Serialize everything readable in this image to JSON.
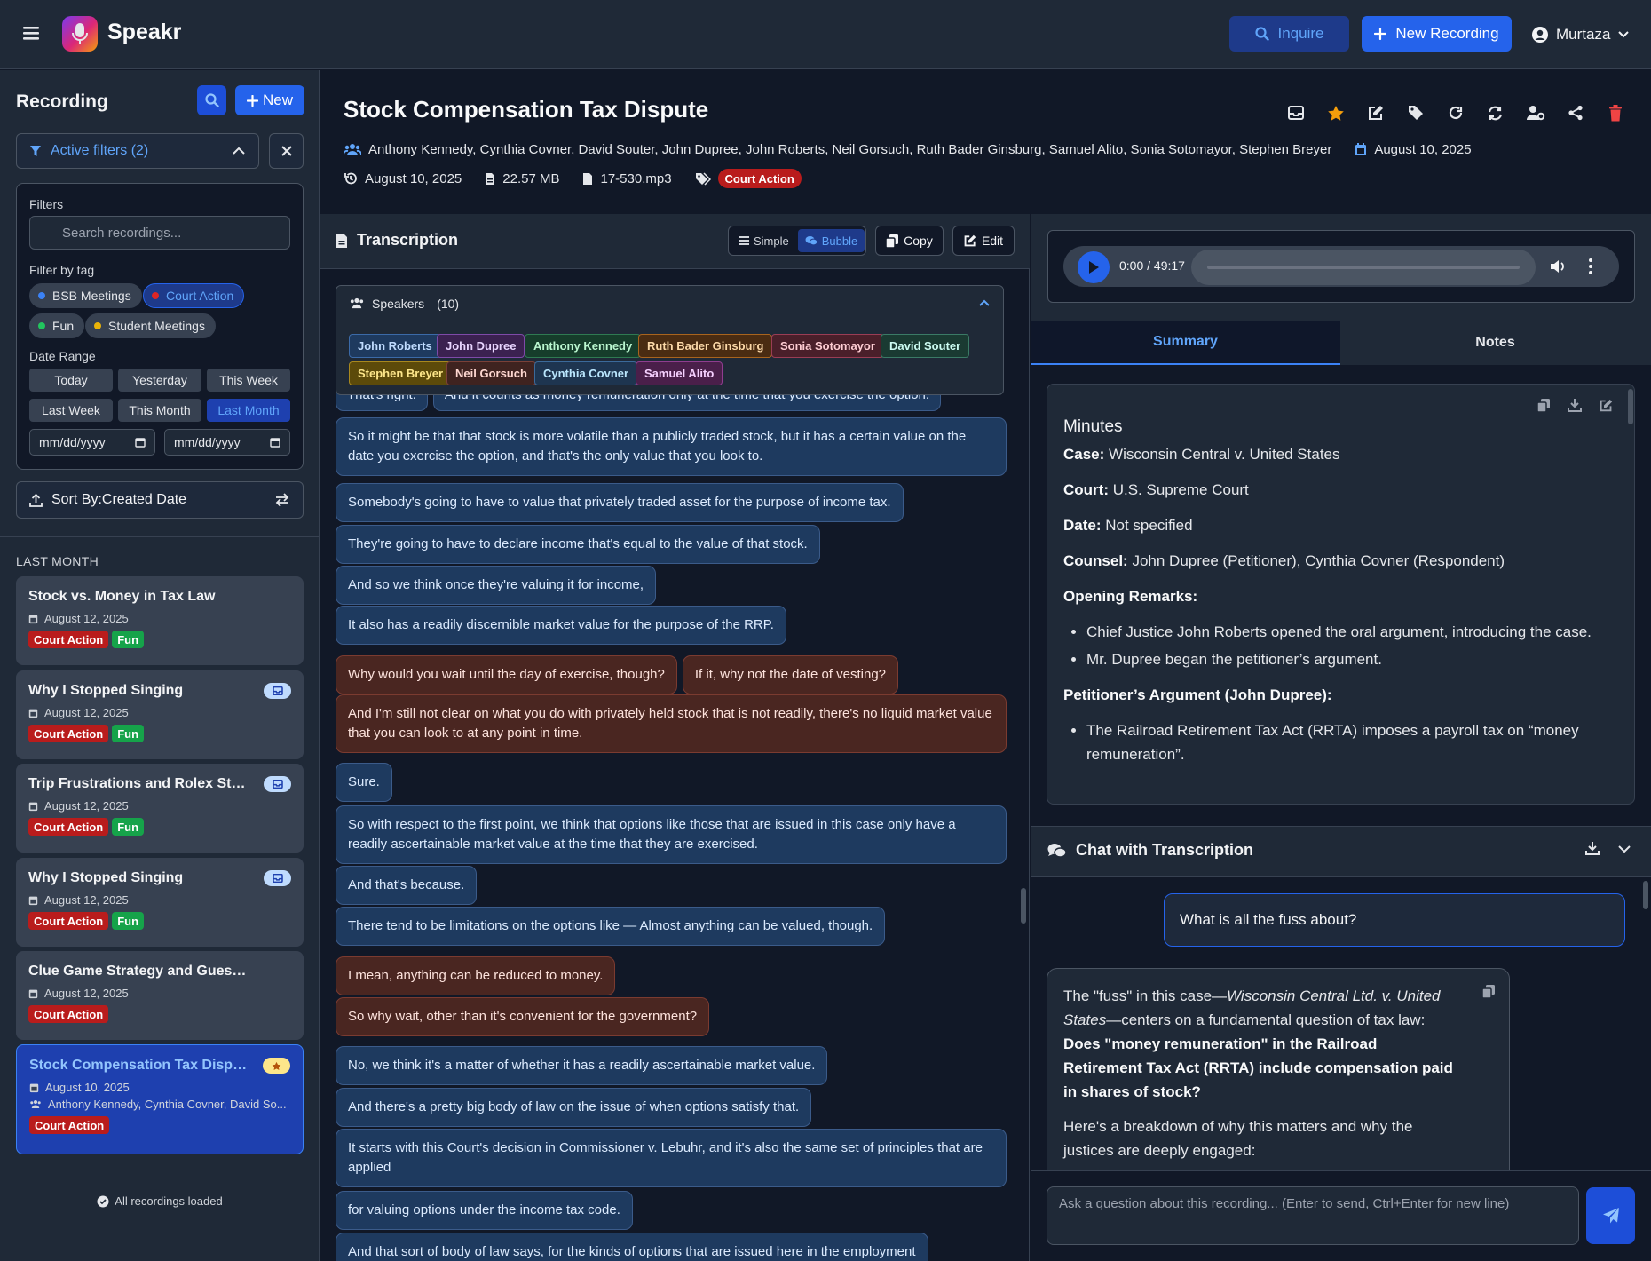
{
  "app": {
    "name": "Speakr",
    "user": "Murtaza",
    "inquire_label": "Inquire",
    "new_recording_label": "New Recording"
  },
  "sidebar": {
    "title": "Recording",
    "new_label": "New",
    "active_filters_label": "Active filters (2)",
    "filters_label": "Filters",
    "search_placeholder": "Search recordings...",
    "filter_by_tag_label": "Filter by tag",
    "tags": [
      {
        "label": "BSB Meetings",
        "color": "#3b82f6",
        "selected": false
      },
      {
        "label": "Court Action",
        "color": "#dc2626",
        "selected": true
      },
      {
        "label": "Fun",
        "color": "#22c55e",
        "selected": false
      },
      {
        "label": "Student Meetings",
        "color": "#eab308",
        "selected": false
      }
    ],
    "date_range_label": "Date Range",
    "date_buttons": [
      "Today",
      "Yesterday",
      "This Week",
      "Last Week",
      "This Month",
      "Last Month"
    ],
    "selected_date_button": "Last Month",
    "date_from_placeholder": "mm/dd/yyyy",
    "date_to_placeholder": "mm/dd/yyyy",
    "sort_label": "Sort By:Created Date",
    "group_label": "LAST MONTH",
    "recordings": [
      {
        "title": "Stock vs. Money in Tax Law",
        "date": "August 12, 2025",
        "tags": [
          "Court Action",
          "Fun"
        ],
        "badge": ""
      },
      {
        "title": "Why I Stopped Singing",
        "date": "August 12, 2025",
        "tags": [
          "Court Action",
          "Fun"
        ],
        "badge": "inbox"
      },
      {
        "title": "Trip Frustrations and Rolex Strategy",
        "date": "August 12, 2025",
        "tags": [
          "Court Action",
          "Fun"
        ],
        "badge": "inbox"
      },
      {
        "title": "Why I Stopped Singing",
        "date": "August 12, 2025",
        "tags": [
          "Court Action",
          "Fun"
        ],
        "badge": "inbox"
      },
      {
        "title": "Clue Game Strategy and Guessing",
        "date": "August 12, 2025",
        "tags": [
          "Court Action"
        ],
        "badge": ""
      },
      {
        "title": "Stock Compensation Tax Dispute",
        "date": "August 10, 2025",
        "participants": "Anthony Kennedy, Cynthia Covner, David So...",
        "tags": [
          "Court Action"
        ],
        "badge": "star",
        "active": true
      }
    ],
    "loaded_note": "All recordings loaded"
  },
  "recording": {
    "title": "Stock Compensation Tax Dispute",
    "participants": "Anthony Kennedy, Cynthia Covner, David Souter, John Dupree, John Roberts, Neil Gorsuch, Ruth Bader Ginsburg, Samuel Alito, Sonia Sotomayor, Stephen Breyer",
    "meeting_date": "August 10, 2025",
    "created_date": "August 10, 2025",
    "file_size": "22.57 MB",
    "file_name": "17-530.mp3",
    "tag": "Court Action"
  },
  "transcription": {
    "title": "Transcription",
    "view_simple": "Simple",
    "view_bubble": "Bubble",
    "copy_label": "Copy",
    "edit_label": "Edit",
    "speakers_label": "Speakers",
    "speakers_count": "(10)",
    "speakers": [
      {
        "name": "John Roberts",
        "bg": "#1e3a5f",
        "border": "#3b6aa8",
        "fg": "#bfdbfe"
      },
      {
        "name": "John Dupree",
        "bg": "#3b2150",
        "border": "#7e4aa8",
        "fg": "#e9d5ff"
      },
      {
        "name": "Anthony Kennedy",
        "bg": "#163d2b",
        "border": "#2f7a52",
        "fg": "#bbf7d0"
      },
      {
        "name": "Ruth Bader Ginsburg",
        "bg": "#4a2c12",
        "border": "#a8641e",
        "fg": "#fcd9a8"
      },
      {
        "name": "Sonia Sotomayor",
        "bg": "#4a1f2a",
        "border": "#9a3d55",
        "fg": "#fecdd3"
      },
      {
        "name": "David Souter",
        "bg": "#1a3a32",
        "border": "#3b7a66",
        "fg": "#ccfbf1"
      },
      {
        "name": "Stephen Breyer",
        "bg": "#5c4a0a",
        "border": "#a8881e",
        "fg": "#fde68a"
      },
      {
        "name": "Neil Gorsuch",
        "bg": "#3f2320",
        "border": "#7a4038",
        "fg": "#fed7d0"
      },
      {
        "name": "Cynthia Covner",
        "bg": "#1e3550",
        "border": "#3b6a9a",
        "fg": "#bae6fd"
      },
      {
        "name": "Samuel Alito",
        "bg": "#4a1f4a",
        "border": "#8f3d8f",
        "fg": "#f5d0fe"
      }
    ],
    "partial_row": {
      "left": "That's right.",
      "right": "And it counts as money remuneration only at the time that you exercise the option."
    },
    "bubbles": [
      {
        "text": "So it might be that that stock is more volatile than a publicly traded stock, but it has a certain value on the date you exercise the option, and that's the only value that you look to.",
        "speaker": "blue"
      },
      {
        "text": "Somebody's going to have to value that privately traded asset for the purpose of income tax.",
        "speaker": "blue"
      },
      {
        "text": "They're going to have to declare income that's equal to the value of that stock.",
        "speaker": "blue"
      },
      {
        "text": "And so we think once they're valuing it for income,",
        "speaker": "blue"
      },
      {
        "text": "It also has a readily discernible market value for the purpose of the RRP.",
        "speaker": "blue"
      },
      {
        "text": "Why would you wait until the day of exercise, though?",
        "speaker": "red",
        "inline": "If it, why not the date of vesting?"
      },
      {
        "text": "And I'm still not clear on what you do with privately held stock that is not readily, there's no liquid market value that you can look to at any point in time.",
        "speaker": "red"
      },
      {
        "text": "Sure.",
        "speaker": "blue"
      },
      {
        "text": "So with respect to the first point, we think that options like those that are issued in this case only have a readily ascertainable market value at the time that they are exercised.",
        "speaker": "blue"
      },
      {
        "text": "And that's because.",
        "speaker": "blue"
      },
      {
        "text": "There tend to be limitations on the options like — Almost anything can be valued, though.",
        "speaker": "blue"
      },
      {
        "text": "I mean, anything can be reduced to money.",
        "speaker": "red"
      },
      {
        "text": "So why wait, other than it's convenient for the government?",
        "speaker": "red"
      },
      {
        "text": "No, we think it's a matter of whether it has a readily ascertainable market value.",
        "speaker": "blue"
      },
      {
        "text": "And there's a pretty big body of law on the issue of when options satisfy that.",
        "speaker": "blue"
      },
      {
        "text": "It starts with this Court's decision in Commissioner v. Lebuhr, and it's also the same set of principles that are applied",
        "speaker": "blue"
      },
      {
        "text": "for valuing options under the income tax code.",
        "speaker": "blue"
      },
      {
        "text": "And that sort of body of law says, for the kinds of options that are issued here in the employment",
        "speaker": "blue"
      }
    ]
  },
  "player": {
    "time": "0:00 / 49:17",
    "progress": 0
  },
  "tabs": {
    "summary": "Summary",
    "notes": "Notes",
    "selected": "Summary"
  },
  "summary": {
    "heading": "Minutes",
    "case_label": "Case:",
    "case_value": "Wisconsin Central v. United States",
    "court_label": "Court:",
    "court_value": "U.S. Supreme Court",
    "date_label": "Date:",
    "date_value": "Not specified",
    "counsel_label": "Counsel:",
    "counsel_value": "John Dupree (Petitioner), Cynthia Covner (Respondent)",
    "opening_label": "Opening Remarks:",
    "opening_items": [
      "Chief Justice John Roberts opened the oral argument, introducing the case.",
      "Mr. Dupree began the petitioner’s argument."
    ],
    "petitioner_label": "Petitioner’s Argument (John Dupree):",
    "petitioner_items": [
      "The Railroad Retirement Tax Act (RRTA) imposes a payroll tax on “money remuneration”."
    ]
  },
  "chat": {
    "title": "Chat with Transcription",
    "user_message": "What is all the fuss about?",
    "bot_intro_1": "The \"fuss\" in this case—",
    "bot_intro_italic": "Wisconsin Central Ltd. v. United States",
    "bot_intro_2": "—centers on a fundamental question of tax law: ",
    "bot_bold": "Does \"money remuneration\" in the Railroad Retirement Tax Act (RRTA) include compensation paid in shares of stock?",
    "bot_para2": "Here's a breakdown of why this matters and why the justices are deeply engaged:",
    "input_placeholder": "Ask a question about this recording... (Enter to send, Ctrl+Enter for new line)"
  }
}
